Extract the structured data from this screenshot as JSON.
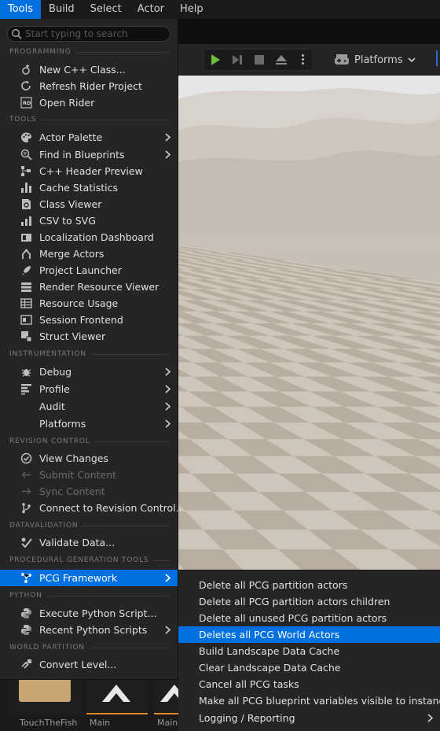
{
  "menubar": {
    "items": [
      {
        "label": "Tools",
        "active": true
      },
      {
        "label": "Build"
      },
      {
        "label": "Select"
      },
      {
        "label": "Actor"
      },
      {
        "label": "Help"
      }
    ]
  },
  "toolbar": {
    "platforms_label": "Platforms"
  },
  "tools_menu": {
    "search_placeholder": "Start typing to search",
    "sections": {
      "programming": "PROGRAMMING",
      "tools": "TOOLS",
      "instrumentation": "INSTRUMENTATION",
      "revision_control": "REVISION CONTROL",
      "datavalidation": "DATAVALIDATION",
      "procedural": "PROCEDURAL GENERATION TOOLS",
      "python": "PYTHON",
      "world_partition": "WORLD PARTITION"
    },
    "items": {
      "new_cpp_class": "New C++ Class...",
      "refresh_rider": "Refresh Rider Project",
      "open_rider": "Open Rider",
      "actor_palette": "Actor Palette",
      "find_in_blueprints": "Find in Blueprints",
      "cpp_header_preview": "C++ Header Preview",
      "cache_statistics": "Cache Statistics",
      "class_viewer": "Class Viewer",
      "csv_to_svg": "CSV to SVG",
      "localization_dashboard": "Localization Dashboard",
      "merge_actors": "Merge Actors",
      "project_launcher": "Project Launcher",
      "render_resource_viewer": "Render Resource Viewer",
      "resource_usage": "Resource Usage",
      "session_frontend": "Session Frontend",
      "struct_viewer": "Struct Viewer",
      "debug": "Debug",
      "profile": "Profile",
      "audit": "Audit",
      "platforms": "Platforms",
      "view_changes": "View Changes",
      "submit_content": "Submit Content",
      "sync_content": "Sync Content",
      "connect_revision": "Connect to Revision Control...",
      "validate_data": "Validate Data...",
      "pcg_framework": "PCG Framework",
      "execute_python": "Execute Python Script...",
      "recent_python": "Recent Python Scripts",
      "convert_level": "Convert Level..."
    }
  },
  "pcg_submenu": {
    "items": [
      "Delete all PCG partition actors",
      "Delete all PCG partition actors children",
      "Delete all unused PCG partition actors",
      "Deletes all PCG World Actors",
      "Build Landscape Data Cache",
      "Clear Landscape Data Cache",
      "Cancel all PCG tasks",
      "Make all PCG blueprint variables visible to instances",
      "Logging / Reporting"
    ],
    "highlighted_index": 3
  },
  "content_browser": {
    "thumbnails": [
      {
        "caption": "TouchTheFish"
      },
      {
        "caption": "Main"
      },
      {
        "caption": "Main"
      }
    ]
  },
  "colors": {
    "accent": "#0070e0",
    "menu_bg": "#252525",
    "play_green": "#6bbf3b"
  }
}
